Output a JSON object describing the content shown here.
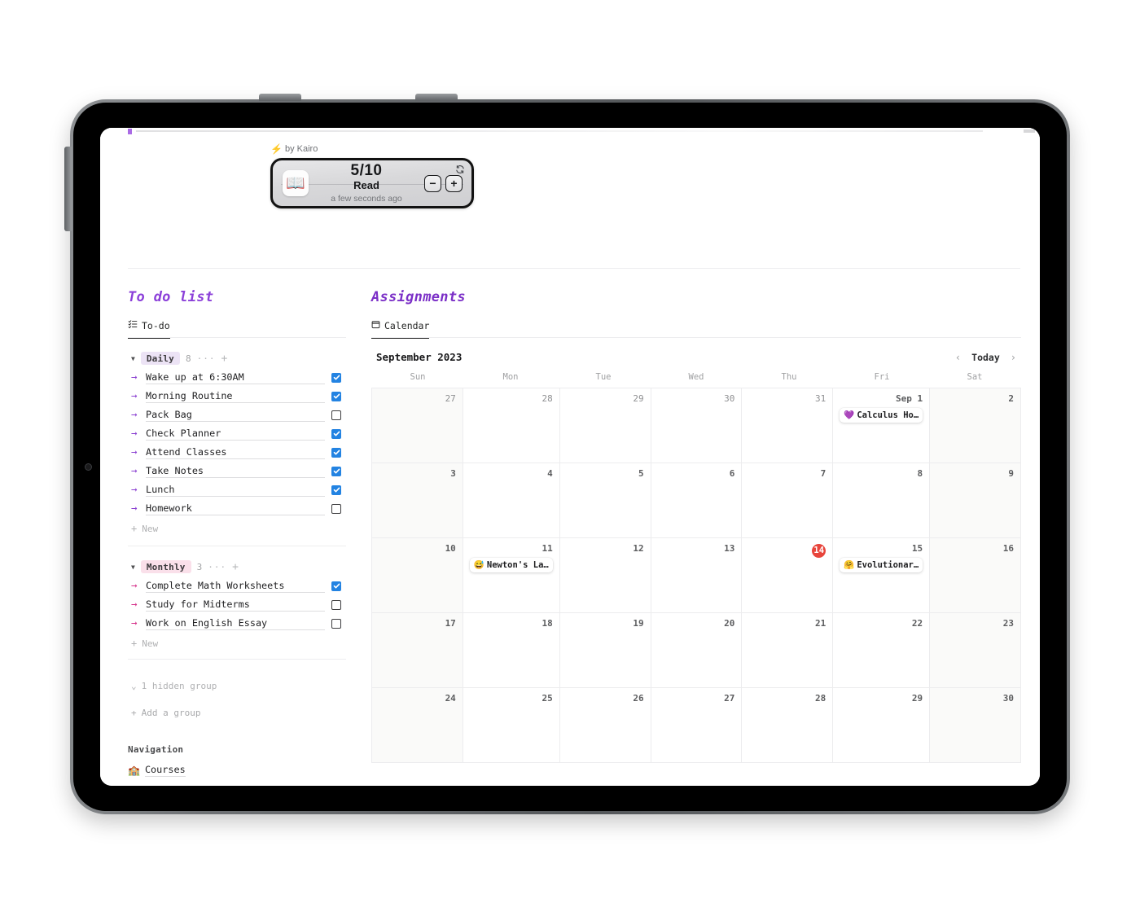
{
  "widget": {
    "byline": "by Kairo",
    "bolt_icon": "bolt-icon",
    "count": "5/10",
    "name": "Read",
    "timestamp": "a few seconds ago",
    "book_icon": "📖",
    "refresh_icon": "refresh-icon",
    "minus_label": "−",
    "plus_label": "+"
  },
  "todo": {
    "title": "To do list",
    "tab_label": "To-do",
    "tab_icon": "todo-list-icon",
    "groups": [
      {
        "name": "Daily",
        "count": "8",
        "chip_class": "daily",
        "arrow_class": "purple",
        "menu_dots": "···",
        "add_icon": "+",
        "items": [
          {
            "label": "Wake up at 6:30AM",
            "checked": true
          },
          {
            "label": "Morning Routine",
            "checked": true
          },
          {
            "label": "Pack Bag",
            "checked": false
          },
          {
            "label": "Check Planner",
            "checked": true
          },
          {
            "label": "Attend Classes",
            "checked": true
          },
          {
            "label": "Take Notes",
            "checked": true
          },
          {
            "label": "Lunch",
            "checked": true
          },
          {
            "label": "Homework",
            "checked": false
          }
        ],
        "new_label": "New"
      },
      {
        "name": "Monthly",
        "count": "3",
        "chip_class": "monthly",
        "arrow_class": "pink",
        "menu_dots": "···",
        "add_icon": "+",
        "items": [
          {
            "label": "Complete Math Worksheets",
            "checked": true
          },
          {
            "label": "Study for Midterms",
            "checked": false
          },
          {
            "label": "Work on English Essay",
            "checked": false
          }
        ],
        "new_label": "New"
      }
    ],
    "hidden_group_label": "1 hidden group",
    "add_group_label": "Add a group"
  },
  "assignments": {
    "title": "Assignments",
    "tab_label": "Calendar",
    "tab_icon": "calendar-icon",
    "month_label": "September 2023",
    "prev_label": "‹",
    "today_label": "Today",
    "next_label": "›",
    "day_headers": [
      "Sun",
      "Mon",
      "Tue",
      "Wed",
      "Thu",
      "Fri",
      "Sat"
    ],
    "cells": [
      {
        "day": "27",
        "muted": true,
        "weekend": true,
        "today": false,
        "events": []
      },
      {
        "day": "28",
        "muted": true,
        "weekend": false,
        "today": false,
        "events": []
      },
      {
        "day": "29",
        "muted": true,
        "weekend": false,
        "today": false,
        "events": []
      },
      {
        "day": "30",
        "muted": true,
        "weekend": false,
        "today": false,
        "events": []
      },
      {
        "day": "31",
        "muted": true,
        "weekend": false,
        "today": false,
        "events": []
      },
      {
        "day": "Sep 1",
        "muted": false,
        "weekend": false,
        "today": false,
        "events": [
          {
            "emoji": "💜",
            "title": "Calculus Ho…"
          }
        ]
      },
      {
        "day": "2",
        "muted": false,
        "weekend": true,
        "today": false,
        "events": []
      },
      {
        "day": "3",
        "muted": false,
        "weekend": true,
        "today": false,
        "events": []
      },
      {
        "day": "4",
        "muted": false,
        "weekend": false,
        "today": false,
        "events": []
      },
      {
        "day": "5",
        "muted": false,
        "weekend": false,
        "today": false,
        "events": []
      },
      {
        "day": "6",
        "muted": false,
        "weekend": false,
        "today": false,
        "events": []
      },
      {
        "day": "7",
        "muted": false,
        "weekend": false,
        "today": false,
        "events": []
      },
      {
        "day": "8",
        "muted": false,
        "weekend": false,
        "today": false,
        "events": []
      },
      {
        "day": "9",
        "muted": false,
        "weekend": true,
        "today": false,
        "events": []
      },
      {
        "day": "10",
        "muted": false,
        "weekend": true,
        "today": false,
        "events": []
      },
      {
        "day": "11",
        "muted": false,
        "weekend": false,
        "today": false,
        "events": [
          {
            "emoji": "😅",
            "title": "Newton's La…"
          }
        ]
      },
      {
        "day": "12",
        "muted": false,
        "weekend": false,
        "today": false,
        "events": []
      },
      {
        "day": "13",
        "muted": false,
        "weekend": false,
        "today": false,
        "events": []
      },
      {
        "day": "14",
        "muted": false,
        "weekend": false,
        "today": true,
        "events": []
      },
      {
        "day": "15",
        "muted": false,
        "weekend": false,
        "today": false,
        "events": [
          {
            "emoji": "🤗",
            "title": "Evolutionar…"
          }
        ]
      },
      {
        "day": "16",
        "muted": false,
        "weekend": true,
        "today": false,
        "events": []
      },
      {
        "day": "17",
        "muted": false,
        "weekend": true,
        "today": false,
        "events": []
      },
      {
        "day": "18",
        "muted": false,
        "weekend": false,
        "today": false,
        "events": []
      },
      {
        "day": "19",
        "muted": false,
        "weekend": false,
        "today": false,
        "events": []
      },
      {
        "day": "20",
        "muted": false,
        "weekend": false,
        "today": false,
        "events": []
      },
      {
        "day": "21",
        "muted": false,
        "weekend": false,
        "today": false,
        "events": []
      },
      {
        "day": "22",
        "muted": false,
        "weekend": false,
        "today": false,
        "events": []
      },
      {
        "day": "23",
        "muted": false,
        "weekend": true,
        "today": false,
        "events": []
      },
      {
        "day": "24",
        "muted": false,
        "weekend": true,
        "today": false,
        "events": []
      },
      {
        "day": "25",
        "muted": false,
        "weekend": false,
        "today": false,
        "events": []
      },
      {
        "day": "26",
        "muted": false,
        "weekend": false,
        "today": false,
        "events": []
      },
      {
        "day": "27",
        "muted": false,
        "weekend": false,
        "today": false,
        "events": []
      },
      {
        "day": "28",
        "muted": false,
        "weekend": false,
        "today": false,
        "events": []
      },
      {
        "day": "29",
        "muted": false,
        "weekend": false,
        "today": false,
        "events": []
      },
      {
        "day": "30",
        "muted": false,
        "weekend": true,
        "today": false,
        "events": []
      }
    ]
  },
  "navigation": {
    "title": "Navigation",
    "items": [
      {
        "label": "Courses",
        "icon": "🏫"
      }
    ]
  },
  "colors": {
    "accent_purple": "#8b3fd9",
    "arrow_purple": "#8a3fd1",
    "arrow_pink": "#d6338b",
    "checkbox_blue": "#2383e2",
    "today_red": "#e8453c",
    "chip_daily_bg": "#ece3f5",
    "chip_monthly_bg": "#fae0ea"
  }
}
